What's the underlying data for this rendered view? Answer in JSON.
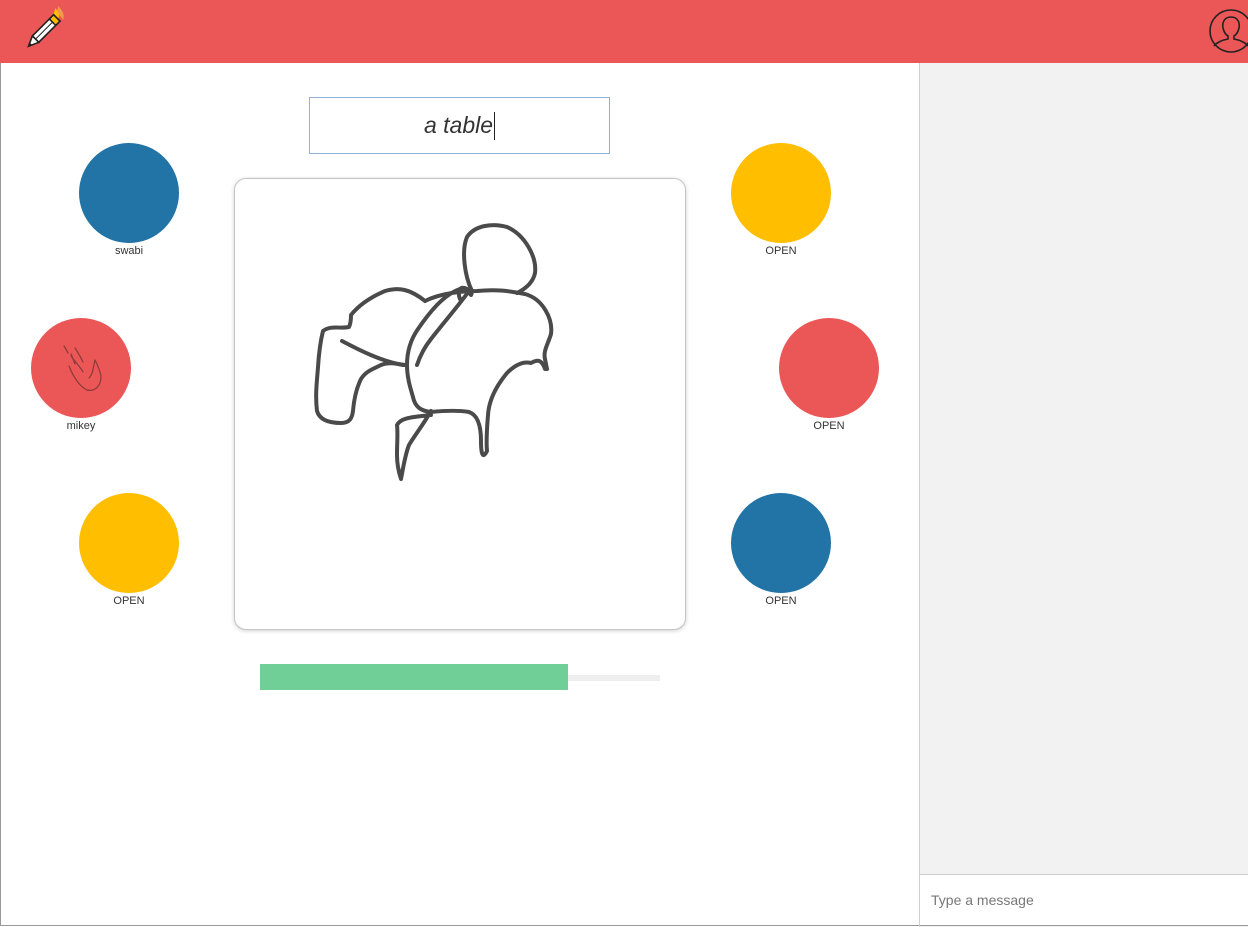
{
  "app": {
    "logo_icon": "pencil-icon",
    "profile_icon": "user-profile-icon",
    "accent_color": "#eb5757"
  },
  "game": {
    "word": "a table",
    "timer_progress": 0.77,
    "progress_color": "#6fcf97"
  },
  "players": [
    {
      "name": "swabi",
      "color": "#2374a6"
    },
    {
      "name": "mikey",
      "color": "#eb5757",
      "avatar_icon": "hand-wave-icon"
    },
    {
      "name": "OPEN",
      "color": "#ffbe00"
    },
    {
      "name": "OPEN",
      "color": "#ffbe00"
    },
    {
      "name": "OPEN",
      "color": "#eb5757"
    },
    {
      "name": "OPEN",
      "color": "#2374a6"
    }
  ],
  "chat": {
    "placeholder": "Type a message"
  }
}
